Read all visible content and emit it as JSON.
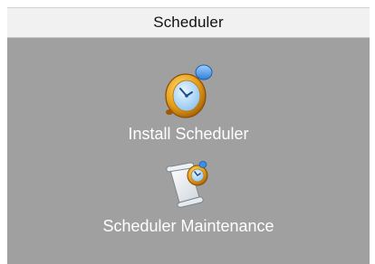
{
  "panel": {
    "title": "Scheduler"
  },
  "items": [
    {
      "label": "Install Scheduler",
      "icon": "alarm-clock-icon"
    },
    {
      "label": "Scheduler Maintenance",
      "icon": "scroll-clock-icon"
    }
  ],
  "colors": {
    "header_bg": "#f1f1f1",
    "body_bg": "#a0a0a0",
    "label_text": "#ffffff",
    "clock_gold": "#e8a01a",
    "clock_blue": "#3b8fe6"
  }
}
